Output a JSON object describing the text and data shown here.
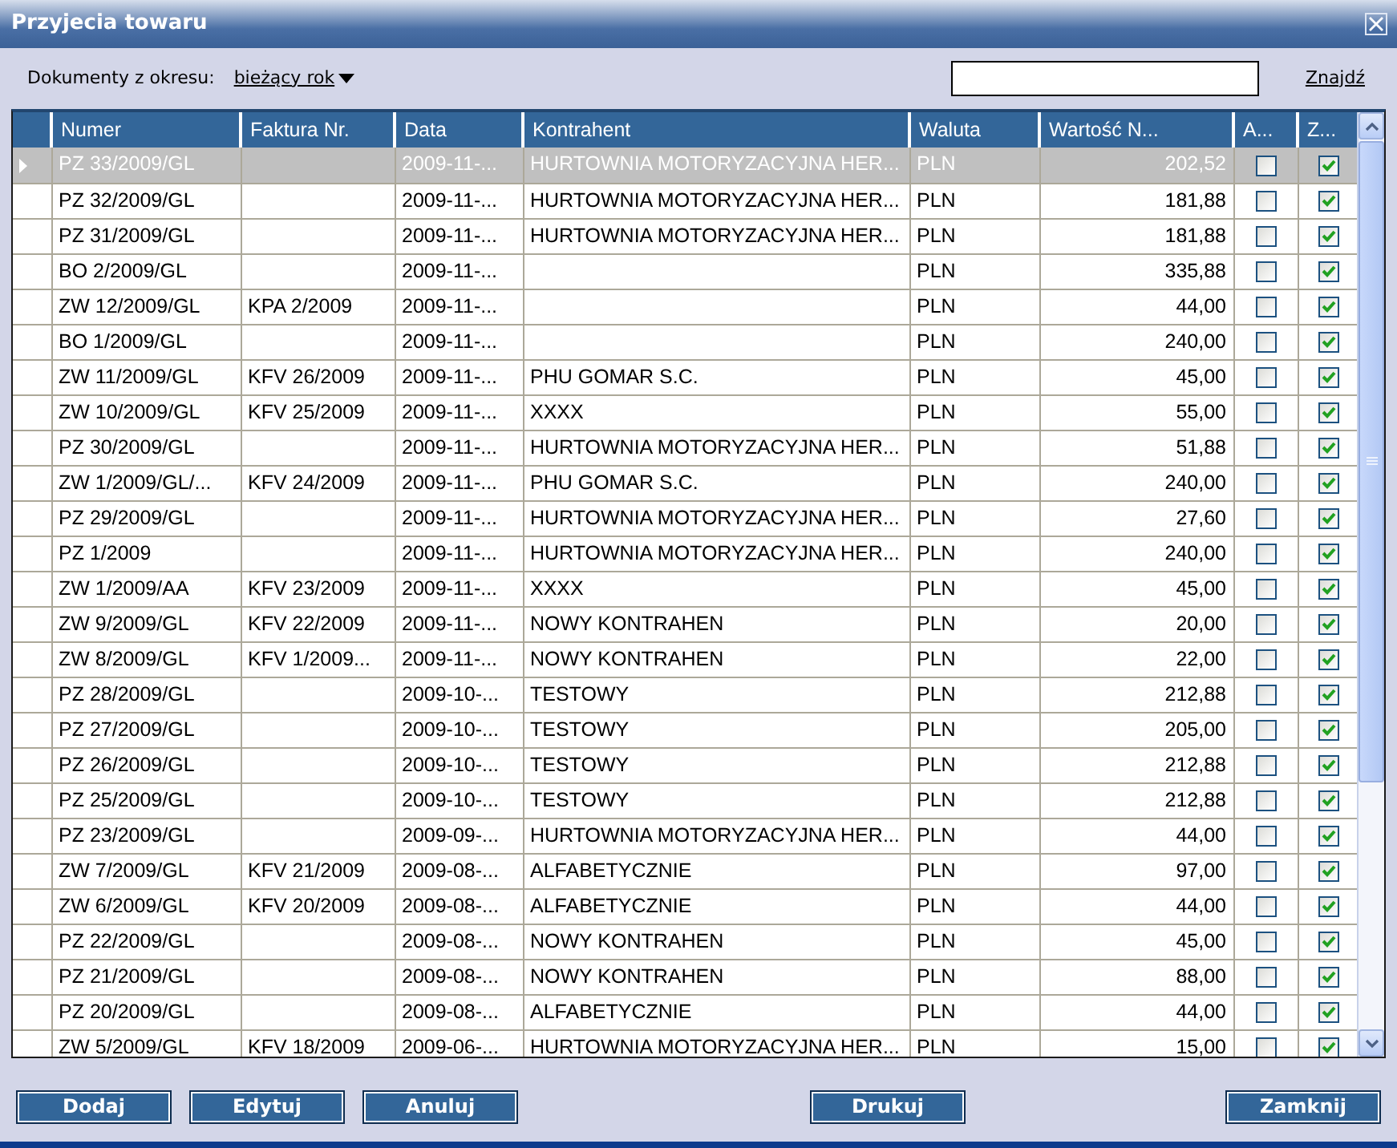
{
  "window": {
    "title": "Przyjecia towaru"
  },
  "filter": {
    "label": "Dokumenty z okresu:",
    "period": "bieżący rok",
    "search_button": "Znajdź"
  },
  "table": {
    "columns": [
      "Numer",
      "Faktura Nr.",
      "Data",
      "Kontrahent",
      "Waluta",
      "Wartość N...",
      "A...",
      "Z..."
    ],
    "rows": [
      {
        "numer": "PZ 33/2009/GL",
        "data": "2009-11-...",
        "kontrahent": "HURTOWNIA MOTORYZACYJNA HER...",
        "waluta": "PLN",
        "wartosc": "202,52",
        "a": false,
        "z": true,
        "selected": true
      },
      {
        "numer": "PZ 32/2009/GL",
        "data": "2009-11-...",
        "kontrahent": "HURTOWNIA MOTORYZACYJNA HER...",
        "waluta": "PLN",
        "wartosc": "181,88",
        "a": false,
        "z": true,
        "selected": false
      },
      {
        "numer": "PZ 31/2009/GL",
        "data": "2009-11-...",
        "kontrahent": "HURTOWNIA MOTORYZACYJNA HER...",
        "waluta": "PLN",
        "wartosc": "181,88",
        "a": false,
        "z": true,
        "selected": false
      },
      {
        "numer": "BO 2/2009/GL",
        "data": "2009-11-...",
        "waluta": "PLN",
        "wartosc": "335,88",
        "a": false,
        "z": true,
        "selected": false
      },
      {
        "numer": "ZW 12/2009/GL",
        "faktura": "KPA 2/2009",
        "data": "2009-11-...",
        "waluta": "PLN",
        "wartosc": "44,00",
        "a": false,
        "z": true,
        "selected": false
      },
      {
        "numer": "BO 1/2009/GL",
        "data": "2009-11-...",
        "waluta": "PLN",
        "wartosc": "240,00",
        "a": false,
        "z": true,
        "selected": false
      },
      {
        "numer": "ZW 11/2009/GL",
        "faktura": "KFV 26/2009",
        "data": "2009-11-...",
        "kontrahent": "PHU GOMAR S.C.",
        "waluta": "PLN",
        "wartosc": "45,00",
        "a": false,
        "z": true,
        "selected": false
      },
      {
        "numer": "ZW 10/2009/GL",
        "faktura": "KFV 25/2009",
        "data": "2009-11-...",
        "kontrahent": "XXXX",
        "waluta": "PLN",
        "wartosc": "55,00",
        "a": false,
        "z": true,
        "selected": false
      },
      {
        "numer": "PZ 30/2009/GL",
        "data": "2009-11-...",
        "kontrahent": "HURTOWNIA MOTORYZACYJNA HER...",
        "waluta": "PLN",
        "wartosc": "51,88",
        "a": false,
        "z": true,
        "selected": false
      },
      {
        "numer": "ZW 1/2009/GL/...",
        "faktura": "KFV 24/2009",
        "data": "2009-11-...",
        "kontrahent": "PHU GOMAR S.C.",
        "waluta": "PLN",
        "wartosc": "240,00",
        "a": false,
        "z": true,
        "selected": false
      },
      {
        "numer": "PZ 29/2009/GL",
        "data": "2009-11-...",
        "kontrahent": "HURTOWNIA MOTORYZACYJNA HER...",
        "waluta": "PLN",
        "wartosc": "27,60",
        "a": false,
        "z": true,
        "selected": false
      },
      {
        "numer": "PZ 1/2009",
        "data": "2009-11-...",
        "kontrahent": "HURTOWNIA MOTORYZACYJNA HER...",
        "waluta": "PLN",
        "wartosc": "240,00",
        "a": false,
        "z": true,
        "selected": false
      },
      {
        "numer": "ZW 1/2009/AA",
        "faktura": "KFV 23/2009",
        "data": "2009-11-...",
        "kontrahent": "XXXX",
        "waluta": "PLN",
        "wartosc": "45,00",
        "a": false,
        "z": true,
        "selected": false
      },
      {
        "numer": "ZW 9/2009/GL",
        "faktura": "KFV 22/2009",
        "data": "2009-11-...",
        "kontrahent": "NOWY KONTRAHEN",
        "waluta": "PLN",
        "wartosc": "20,00",
        "a": false,
        "z": true,
        "selected": false
      },
      {
        "numer": "ZW 8/2009/GL",
        "faktura": "KFV 1/2009...",
        "data": "2009-11-...",
        "kontrahent": "NOWY KONTRAHEN",
        "waluta": "PLN",
        "wartosc": "22,00",
        "a": false,
        "z": true,
        "selected": false
      },
      {
        "numer": "PZ 28/2009/GL",
        "data": "2009-10-...",
        "kontrahent": "TESTOWY",
        "waluta": "PLN",
        "wartosc": "212,88",
        "a": false,
        "z": true,
        "selected": false
      },
      {
        "numer": "PZ 27/2009/GL",
        "data": "2009-10-...",
        "kontrahent": "TESTOWY",
        "waluta": "PLN",
        "wartosc": "205,00",
        "a": false,
        "z": true,
        "selected": false
      },
      {
        "numer": "PZ 26/2009/GL",
        "data": "2009-10-...",
        "kontrahent": "TESTOWY",
        "waluta": "PLN",
        "wartosc": "212,88",
        "a": false,
        "z": true,
        "selected": false
      },
      {
        "numer": "PZ 25/2009/GL",
        "data": "2009-10-...",
        "kontrahent": "TESTOWY",
        "waluta": "PLN",
        "wartosc": "212,88",
        "a": false,
        "z": true,
        "selected": false
      },
      {
        "numer": "PZ 23/2009/GL",
        "data": "2009-09-...",
        "kontrahent": "HURTOWNIA MOTORYZACYJNA HER...",
        "waluta": "PLN",
        "wartosc": "44,00",
        "a": false,
        "z": true,
        "selected": false
      },
      {
        "numer": "ZW 7/2009/GL",
        "faktura": "KFV 21/2009",
        "data": "2009-08-...",
        "kontrahent": "ALFABETYCZNIE",
        "waluta": "PLN",
        "wartosc": "97,00",
        "a": false,
        "z": true,
        "selected": false
      },
      {
        "numer": "ZW 6/2009/GL",
        "faktura": "KFV 20/2009",
        "data": "2009-08-...",
        "kontrahent": "ALFABETYCZNIE",
        "waluta": "PLN",
        "wartosc": "44,00",
        "a": false,
        "z": true,
        "selected": false
      },
      {
        "numer": "PZ 22/2009/GL",
        "data": "2009-08-...",
        "kontrahent": "NOWY KONTRAHEN",
        "waluta": "PLN",
        "wartosc": "45,00",
        "a": false,
        "z": true,
        "selected": false
      },
      {
        "numer": "PZ 21/2009/GL",
        "data": "2009-08-...",
        "kontrahent": "NOWY KONTRAHEN",
        "waluta": "PLN",
        "wartosc": "88,00",
        "a": false,
        "z": true,
        "selected": false
      },
      {
        "numer": "PZ 20/2009/GL",
        "data": "2009-08-...",
        "kontrahent": "ALFABETYCZNIE",
        "waluta": "PLN",
        "wartosc": "44,00",
        "a": false,
        "z": true,
        "selected": false
      },
      {
        "numer": "ZW 5/2009/GL",
        "faktura": "KFV 18/2009",
        "data": "2009-06-...",
        "kontrahent": "HURTOWNIA MOTORYZACYJNA HER...",
        "waluta": "PLN",
        "wartosc": "15,00",
        "a": false,
        "z": true,
        "selected": false
      }
    ]
  },
  "buttons_left": [
    "Dodaj",
    "Edytuj",
    "Anuluj"
  ],
  "button_center": "Drukuj",
  "button_right": "Zamknij"
}
